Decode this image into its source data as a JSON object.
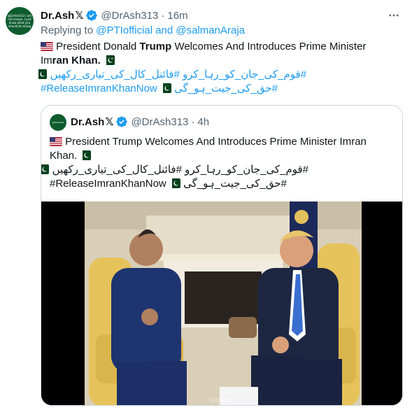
{
  "author": {
    "name": "Dr.Ash",
    "x_mark": "𝕏",
    "handle": "@DrAsh313",
    "separator": "·",
    "time": "16m",
    "avatar_text": "@DrAsh313 I am not known. I just know what you should be doing"
  },
  "replying": {
    "prefix": "Replying to",
    "user1": "@PTIofficial",
    "conj": "and",
    "user2": "@salmanAraja"
  },
  "tweet": {
    "line1_pre": "President Donald",
    "line1_bold": "Trump",
    "line1_post": "Welcomes And Introduces Prime Minister",
    "line2_pre": "Im",
    "line2_bold": "ran Khan.",
    "hashtags_line1": "#قوم_کی_جان_کو_رہا_کرو #فائنل_کال_کی_تیاری_رکھیں",
    "hashtags_line2_a": "#ReleaseImranKhanNow",
    "hashtags_line2_b": "#حق_کی_جیت_ہو_گی"
  },
  "quote": {
    "name": "Dr.Ash",
    "x_mark": "𝕏",
    "handle": "@DrAsh313",
    "separator": "·",
    "time": "4h",
    "line1": "President Trump Welcomes And Introduces Prime Minister Imran",
    "line2": "Khan.",
    "hashtags_line1": "#قوم_کی_جان_کو_رہا_کرو #فائنل_کال_کی_تیاری_رکھیں",
    "hashtags_line2_a": "#ReleaseImranKhanNow",
    "hashtags_line2_b": "#حق_کی_جیت_ہو_گی",
    "avatar_text": "@DrAsh313"
  },
  "media": {
    "watermark": "Mishkat"
  },
  "colors": {
    "link": "#1d9bf0",
    "muted": "#536471",
    "verified": "#1d9bf0"
  },
  "icons": [
    "verified-badge-icon",
    "more-options-icon",
    "us-flag-icon",
    "pakistan-flag-icon"
  ]
}
